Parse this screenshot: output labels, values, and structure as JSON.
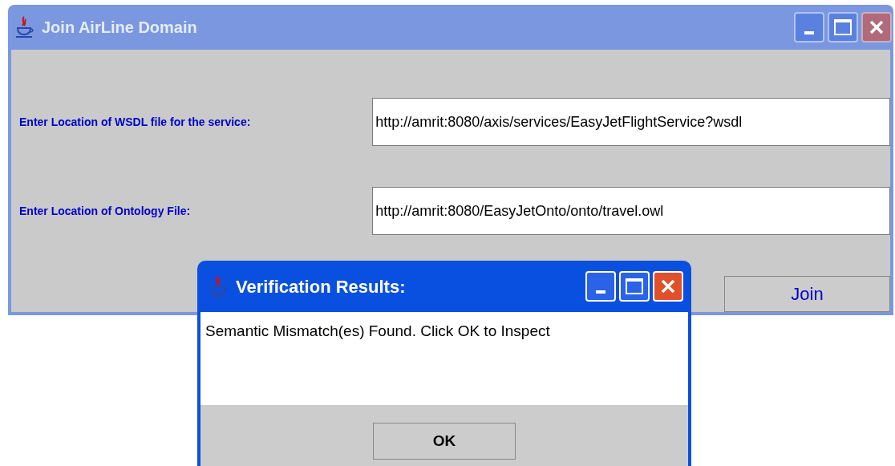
{
  "main_window": {
    "title": "Join AirLine Domain",
    "active": false,
    "fields": [
      {
        "label": "Enter Location of WSDL file for the service:",
        "value": "http://amrit:8080/axis/services/EasyJetFlightService?wsdl"
      },
      {
        "label": "Enter Location of Ontology File:",
        "value": "http://amrit:8080/EasyJetOnto/onto/travel.owl"
      }
    ],
    "button": "Join"
  },
  "dialog": {
    "title": "Verification Results:",
    "active": true,
    "message": "Semantic Mismatch(es) Found. Click OK to Inspect",
    "button": "OK"
  }
}
